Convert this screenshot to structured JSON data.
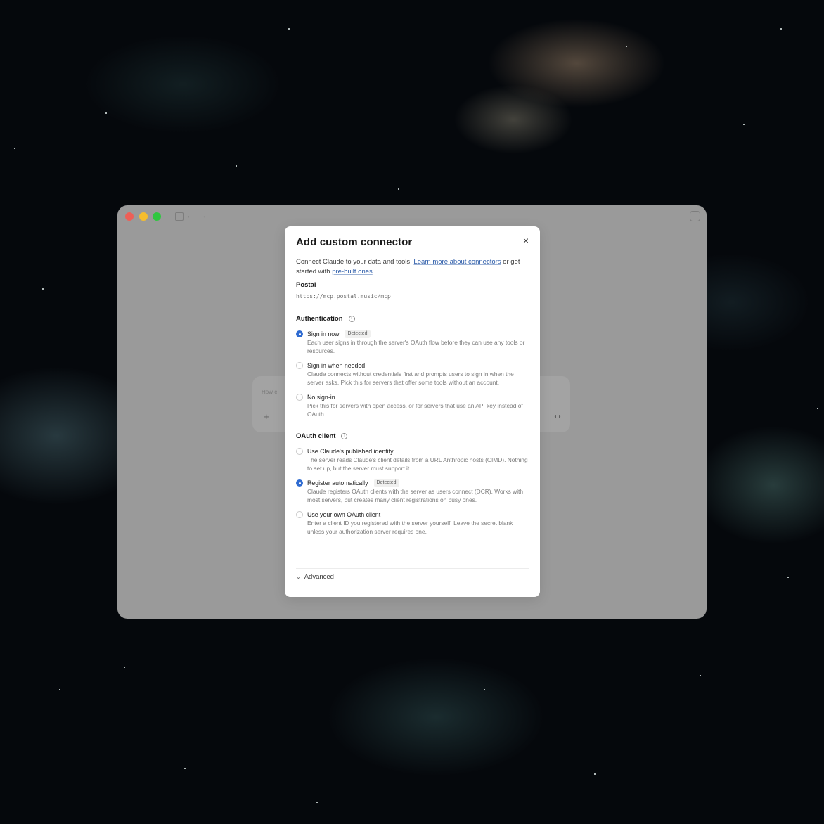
{
  "window": {
    "composer_placeholder": "How c",
    "composer_plus": "+",
    "composer_voice": "◖◗"
  },
  "dialog": {
    "title": "Add custom connector",
    "close_icon": "×",
    "intro_text": "Connect Claude to your data and tools. ",
    "intro_link": "Learn more about connectors",
    "intro_mid": " or get started with ",
    "intro_link2": "pre-built ones",
    "intro_end": ".",
    "connector_name": "Postal",
    "connector_url": "https://mcp.postal.music/mcp",
    "authentication": {
      "heading": "Authentication",
      "options": [
        {
          "title": "Sign in now",
          "badge": "Detected",
          "desc": "Each user signs in through the server's OAuth flow before they can use any tools or resources.",
          "selected": true
        },
        {
          "title": "Sign in when needed",
          "desc": "Claude connects without credentials first and prompts users to sign in when the server asks. Pick this for servers that offer some tools without an account.",
          "selected": false
        },
        {
          "title": "No sign-in",
          "desc": "Pick this for servers with open access, or for servers that use an API key instead of OAuth.",
          "selected": false
        }
      ]
    },
    "oauth_client": {
      "heading": "OAuth client",
      "options": [
        {
          "title": "Use Claude's published identity",
          "desc": "The server reads Claude's client details from a URL Anthropic hosts (CIMD). Nothing to set up, but the server must support it.",
          "selected": false
        },
        {
          "title": "Register automatically",
          "badge": "Detected",
          "desc": "Claude registers OAuth clients with the server as users connect (DCR). Works with most servers, but creates many client registrations on busy ones.",
          "selected": true
        },
        {
          "title": "Use your own OAuth client",
          "desc": "Enter a client ID you registered with the server yourself. Leave the secret blank unless your authorization server requires one.",
          "selected": false
        }
      ]
    },
    "advanced_label": "Advanced"
  },
  "colors": {
    "accent": "#2f6bd1",
    "window_dim": "#9a9a9a",
    "link": "#2a5aa8"
  },
  "icons": {
    "close": "close-icon",
    "info": "info-icon",
    "chevron": "chevron-down-icon"
  }
}
